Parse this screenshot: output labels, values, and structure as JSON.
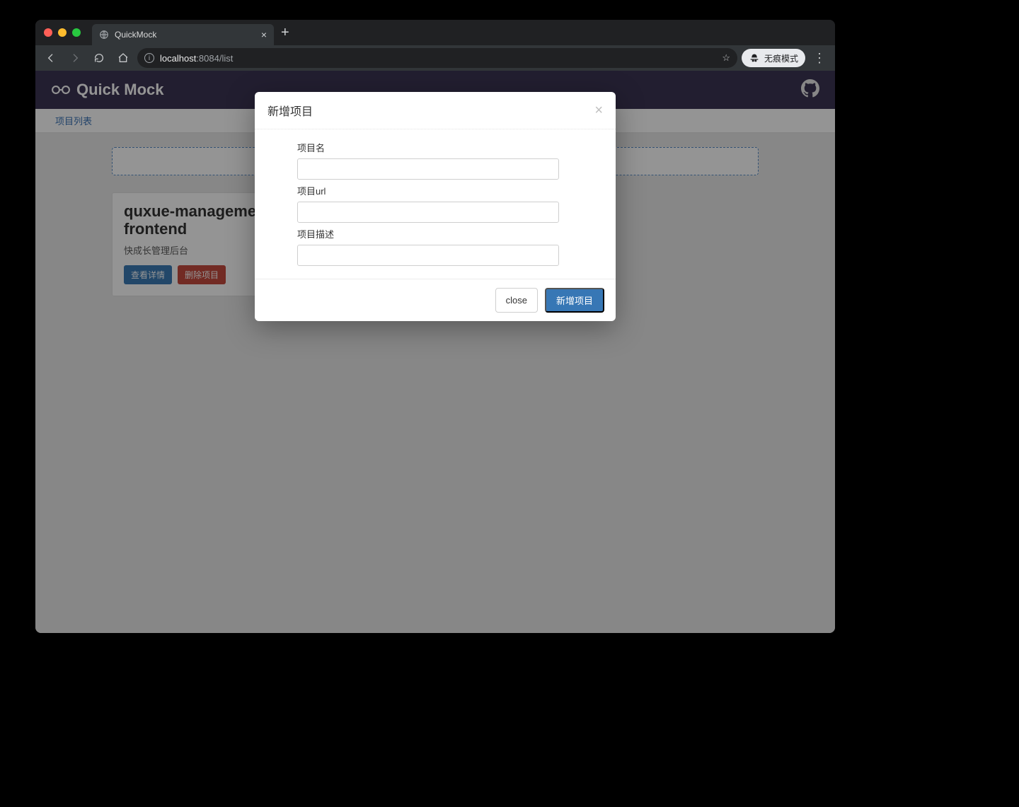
{
  "browser": {
    "tab_title": "QuickMock",
    "url": {
      "host": "localhost",
      "port": ":8084",
      "path": "/list"
    },
    "incognito_label": "无痕模式"
  },
  "app": {
    "brand": "Quick Mock",
    "breadcrumb": "项目列表"
  },
  "content": {
    "add_strip_placeholder": "",
    "card": {
      "title": "quxue-management-frontend",
      "subtitle": "快成长管理后台",
      "view_label": "查看详情",
      "delete_label": "删除项目"
    }
  },
  "modal": {
    "title": "新增项目",
    "fields": {
      "name_label": "项目名",
      "url_label": "项目url",
      "desc_label": "项目描述",
      "name_value": "",
      "url_value": "",
      "desc_value": ""
    },
    "close_label": "close",
    "submit_label": "新增项目"
  }
}
